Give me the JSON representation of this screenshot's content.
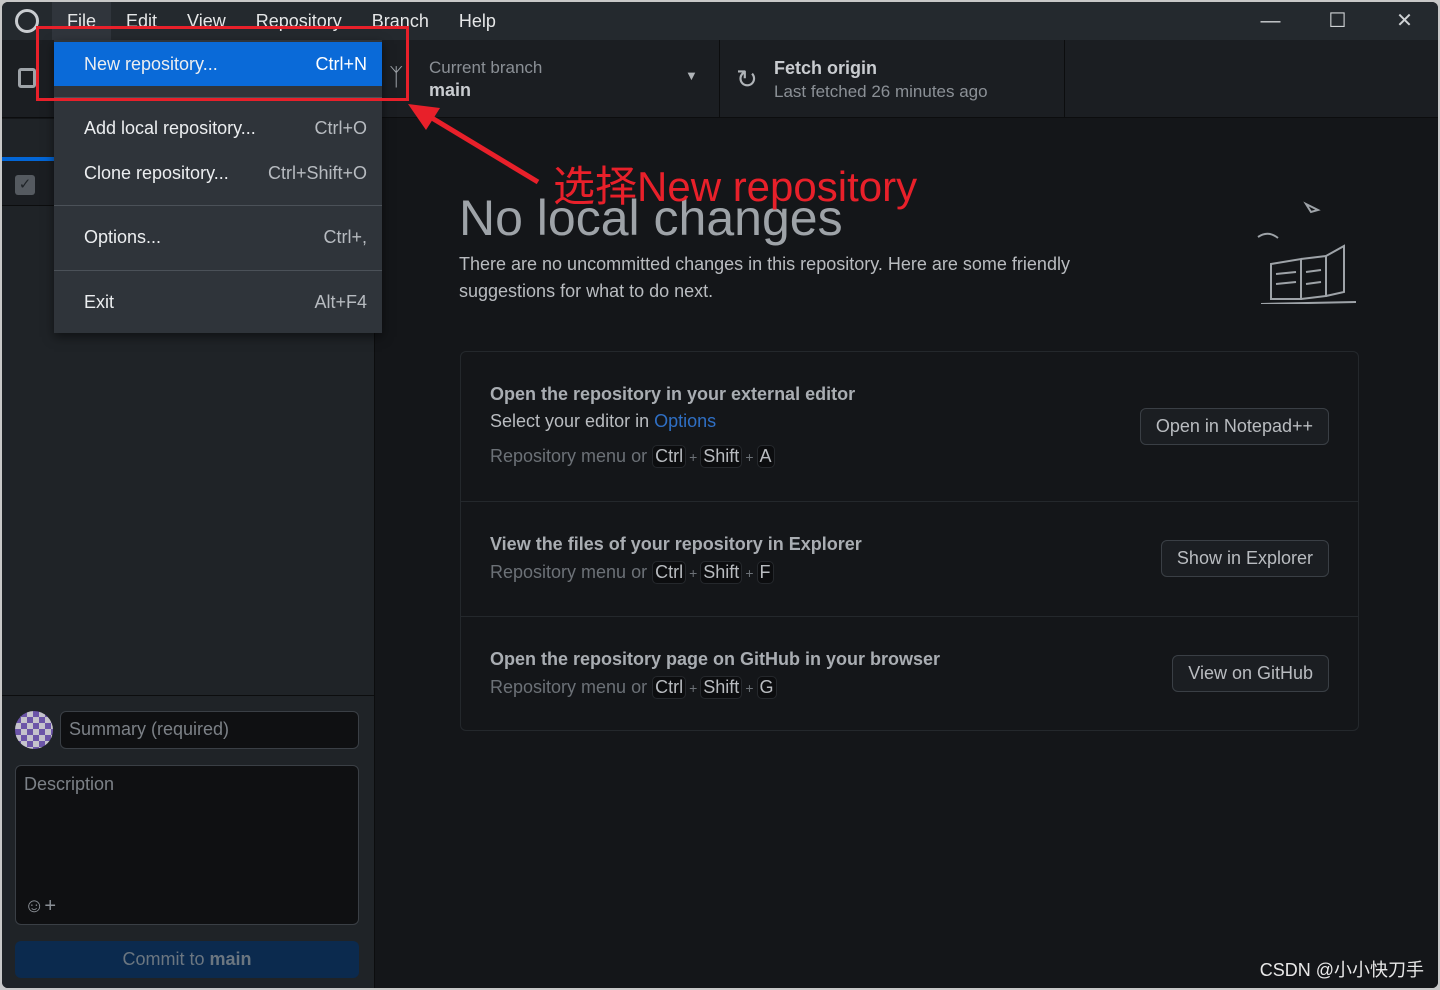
{
  "menubar": {
    "items": [
      "File",
      "Edit",
      "View",
      "Repository",
      "Branch",
      "Help"
    ],
    "window_controls": [
      "minimize",
      "maximize",
      "close"
    ]
  },
  "toolbar": {
    "branch_label": "Current branch",
    "branch_value": "main",
    "fetch_title": "Fetch origin",
    "fetch_sub": "Last fetched 26 minutes ago"
  },
  "file_menu": [
    {
      "label": "New repository...",
      "shortcut": "Ctrl+N"
    },
    {
      "label": "Add local repository...",
      "shortcut": "Ctrl+O"
    },
    {
      "label": "Clone repository...",
      "shortcut": "Ctrl+Shift+O"
    },
    {
      "label": "Options...",
      "shortcut": "Ctrl+,"
    },
    {
      "label": "Exit",
      "shortcut": "Alt+F4"
    }
  ],
  "commit": {
    "summary_placeholder": "Summary (required)",
    "description_placeholder": "Description",
    "button_prefix": "Commit to ",
    "button_branch": "main"
  },
  "main": {
    "title": "No local changes",
    "intro": "There are no uncommitted changes in this repository. Here are some friendly suggestions for what to do next.",
    "cards": [
      {
        "title": "Open the repository in your external editor",
        "sub_prefix": "Select your editor in ",
        "sub_link": "Options",
        "hint": "Repository menu or",
        "keys": [
          "Ctrl",
          "Shift",
          "A"
        ],
        "button": "Open in Notepad++"
      },
      {
        "title": "View the files of your repository in Explorer",
        "hint": "Repository menu or",
        "keys": [
          "Ctrl",
          "Shift",
          "F"
        ],
        "button": "Show in Explorer"
      },
      {
        "title": "Open the repository page on GitHub in your browser",
        "hint": "Repository menu or",
        "keys": [
          "Ctrl",
          "Shift",
          "G"
        ],
        "button": "View on GitHub"
      }
    ]
  },
  "annotation": {
    "text": "选择New repository",
    "color": "#e8202a"
  },
  "watermark": "CSDN @小小快刀手",
  "colors": {
    "accent": "#0366d6",
    "highlight": "#0a6ad8"
  }
}
